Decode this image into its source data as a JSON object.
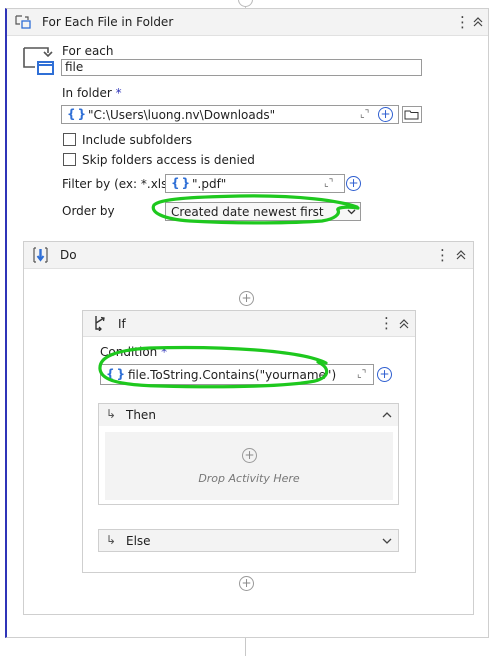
{
  "foreach": {
    "title": "For Each File in Folder",
    "for_each_label": "For each",
    "item_value": "file",
    "in_folder_label": "In folder",
    "required_mark": "*",
    "folder_value": "\"C:\\Users\\luong.nv\\Downloads\"",
    "include_subfolders_label": "Include subfolders",
    "skip_denied_label": "Skip folders access is denied",
    "filter_label": "Filter by (ex: *.xlsx)",
    "filter_value": "\".pdf\"",
    "order_by_label": "Order by",
    "order_by_value": "Created date newest first",
    "curly_glyph": "{}"
  },
  "do": {
    "title": "Do"
  },
  "if_activity": {
    "title": "If",
    "condition_label": "Condition",
    "condition_value": "file.ToString.Contains(\"yourname\")",
    "then_label": "Then",
    "else_label": "Else",
    "drop_text": "Drop Activity Here"
  },
  "colors": {
    "accent": "#2f34b8",
    "highlight": "#1ec81e"
  }
}
